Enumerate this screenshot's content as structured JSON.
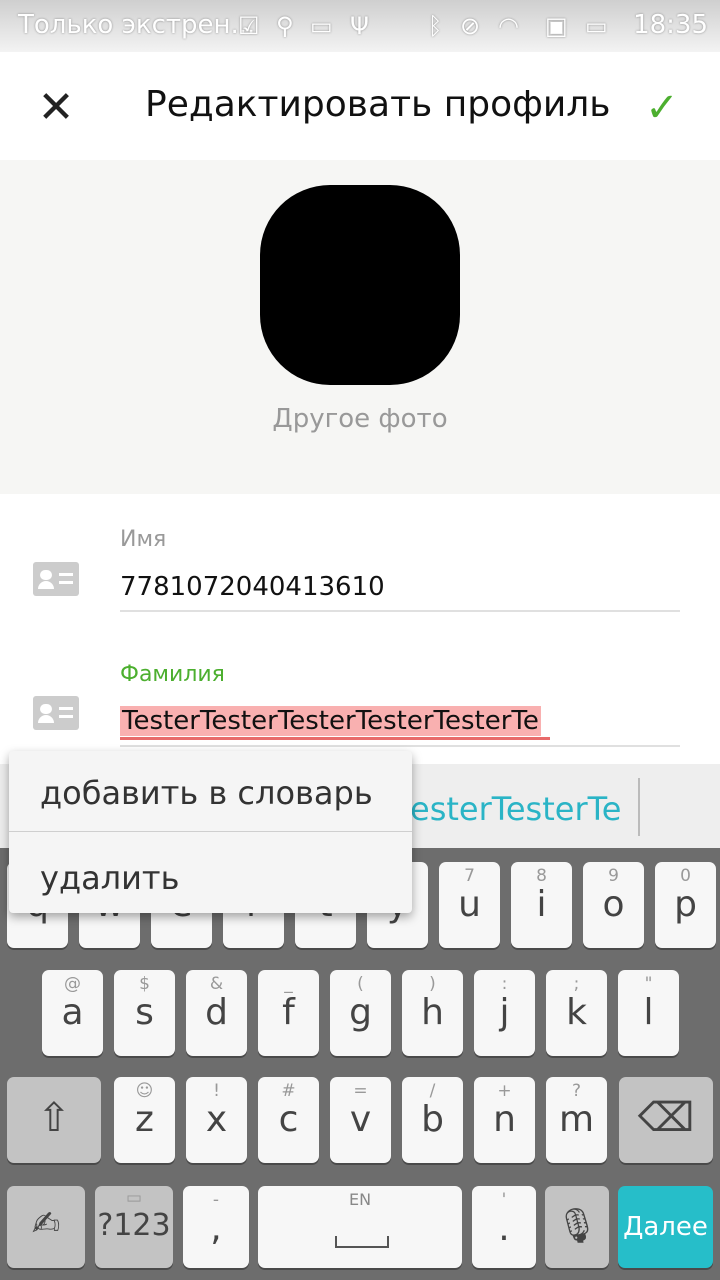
{
  "status_bar": {
    "left_text": "Только экстрен...",
    "time": "18:35",
    "icons": [
      "checkbox-icon",
      "location-icon",
      "card-icon",
      "usb-icon",
      "bluetooth-icon",
      "mute-icon",
      "wifi-icon",
      "sim-icon",
      "battery-icon"
    ]
  },
  "app_bar": {
    "title": "Редактировать профиль",
    "close_icon": "close-icon",
    "confirm_icon": "check-icon"
  },
  "profile": {
    "change_photo_label": "Другое фото"
  },
  "fields": {
    "name": {
      "label": "Имя",
      "value": "7781072040413610"
    },
    "surname": {
      "label": "Фамилия",
      "value": "TesterTesterTesterTesterTesterTe"
    }
  },
  "suggestion": {
    "text": "esterTesterTe"
  },
  "popup_menu": {
    "items": [
      "добавить в словарь",
      "удалить"
    ]
  },
  "keyboard": {
    "row1": [
      {
        "main": "q",
        "sub": "1"
      },
      {
        "main": "w",
        "sub": "2"
      },
      {
        "main": "e",
        "sub": "3"
      },
      {
        "main": "r",
        "sub": "4"
      },
      {
        "main": "t",
        "sub": "5"
      },
      {
        "main": "y",
        "sub": "6"
      },
      {
        "main": "u",
        "sub": "7"
      },
      {
        "main": "i",
        "sub": "8"
      },
      {
        "main": "o",
        "sub": "9"
      },
      {
        "main": "p",
        "sub": "0"
      }
    ],
    "row2": [
      {
        "main": "a",
        "sub": "@"
      },
      {
        "main": "s",
        "sub": "$"
      },
      {
        "main": "d",
        "sub": "&"
      },
      {
        "main": "f",
        "sub": "_"
      },
      {
        "main": "g",
        "sub": "("
      },
      {
        "main": "h",
        "sub": ")"
      },
      {
        "main": "j",
        "sub": ":"
      },
      {
        "main": "k",
        "sub": ";"
      },
      {
        "main": "l",
        "sub": "\""
      }
    ],
    "row3": [
      {
        "main": "z",
        "sub": "☺"
      },
      {
        "main": "x",
        "sub": "!"
      },
      {
        "main": "c",
        "sub": "#"
      },
      {
        "main": "v",
        "sub": "="
      },
      {
        "main": "b",
        "sub": "/"
      },
      {
        "main": "n",
        "sub": "+"
      },
      {
        "main": "m",
        "sub": "?"
      }
    ],
    "shift_icon": "shift-icon",
    "backspace_icon": "backspace-icon",
    "gesture_icon": "gesture-icon",
    "symbols_label": "?123",
    "comma_label": ",",
    "comma_sub": "-",
    "space_label": "EN",
    "period_label": ".",
    "period_sub": "'",
    "mic_icon": "mic-icon",
    "action_label": "Далее"
  }
}
